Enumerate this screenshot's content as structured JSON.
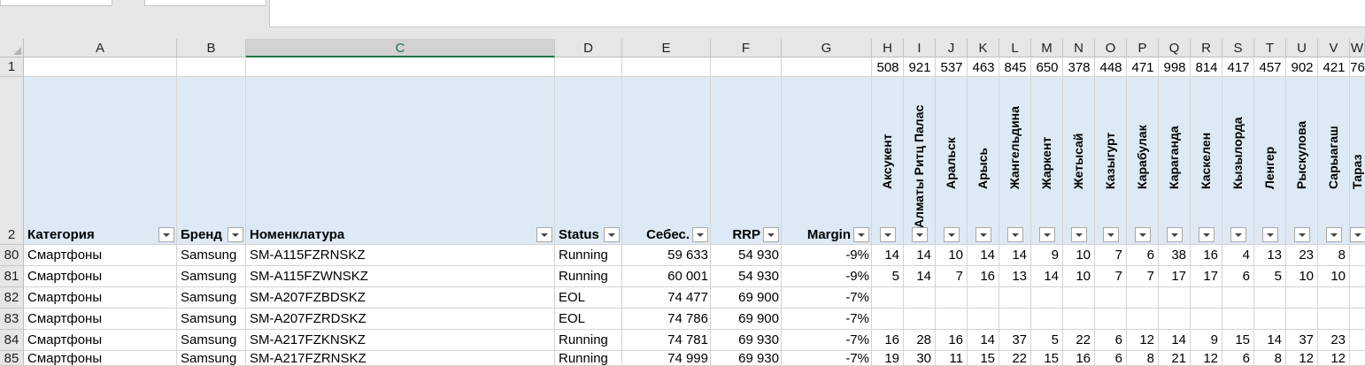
{
  "column_letters": [
    "A",
    "B",
    "C",
    "D",
    "E",
    "F",
    "G",
    "H",
    "I",
    "J",
    "K",
    "L",
    "M",
    "N",
    "O",
    "P",
    "Q",
    "R",
    "S",
    "T",
    "U",
    "V",
    "W"
  ],
  "row1_values": [
    "508",
    "921",
    "537",
    "463",
    "845",
    "650",
    "378",
    "448",
    "471",
    "998",
    "814",
    "417",
    "457",
    "902",
    "421",
    "76"
  ],
  "headers": {
    "category": "Категория",
    "brand": "Бренд",
    "nomenclature": "Номенклатура",
    "status": "Status",
    "cost": "Себес.",
    "rrp": "RRP",
    "margin": "Margin"
  },
  "cities": [
    "Аксукент",
    "Алматы Ритц Палас",
    "Аральск",
    "Арысь",
    "Жангельдина",
    "Жаркент",
    "Жетысай",
    "Казыгурт",
    "Карабулак",
    "Караганда",
    "Каскелен",
    "Кызылорда",
    "Ленгер",
    "Рыскулова",
    "Сарыагаш",
    "Тараз"
  ],
  "row_numbers": [
    "1",
    "2",
    "80",
    "81",
    "82",
    "83",
    "84",
    "85"
  ],
  "rows": [
    {
      "category": "Смартфоны",
      "brand": "Samsung",
      "sku": "SM-A115FZRNSKZ",
      "status": "Running",
      "cost": "59 633",
      "rrp": "54 930",
      "margin": "-9%",
      "stock": [
        "14",
        "14",
        "10",
        "14",
        "14",
        "9",
        "10",
        "7",
        "6",
        "38",
        "16",
        "4",
        "13",
        "23",
        "8",
        ""
      ]
    },
    {
      "category": "Смартфоны",
      "brand": "Samsung",
      "sku": "SM-A115FZWNSKZ",
      "status": "Running",
      "cost": "60 001",
      "rrp": "54 930",
      "margin": "-9%",
      "stock": [
        "5",
        "14",
        "7",
        "16",
        "13",
        "14",
        "10",
        "7",
        "7",
        "17",
        "17",
        "6",
        "5",
        "10",
        "10",
        ""
      ]
    },
    {
      "category": "Смартфоны",
      "brand": "Samsung",
      "sku": "SM-A207FZBDSKZ",
      "status": "EOL",
      "cost": "74 477",
      "rrp": "69 900",
      "margin": "-7%",
      "stock": [
        "",
        "",
        "",
        "",
        "",
        "",
        "",
        "",
        "",
        "",
        "",
        "",
        "",
        "",
        "",
        ""
      ]
    },
    {
      "category": "Смартфоны",
      "brand": "Samsung",
      "sku": "SM-A207FZRDSKZ",
      "status": "EOL",
      "cost": "74 786",
      "rrp": "69 900",
      "margin": "-7%",
      "stock": [
        "",
        "",
        "",
        "",
        "",
        "",
        "",
        "",
        "",
        "",
        "",
        "",
        "",
        "",
        "",
        ""
      ]
    },
    {
      "category": "Смартфоны",
      "brand": "Samsung",
      "sku": "SM-A217FZKNSKZ",
      "status": "Running",
      "cost": "74 781",
      "rrp": "69 930",
      "margin": "-7%",
      "stock": [
        "16",
        "28",
        "16",
        "14",
        "37",
        "5",
        "22",
        "6",
        "12",
        "14",
        "9",
        "15",
        "14",
        "37",
        "23",
        ""
      ]
    },
    {
      "category": "Смартфоны",
      "brand": "Samsung",
      "sku": "SM-A217FZRNSKZ",
      "status": "Running",
      "cost": "74 999",
      "rrp": "69 930",
      "margin": "-7%",
      "stock": [
        "19",
        "30",
        "11",
        "15",
        "22",
        "15",
        "16",
        "6",
        "8",
        "21",
        "12",
        "6",
        "8",
        "12",
        "12",
        ""
      ]
    }
  ],
  "colors": {
    "header_fill": "#dde9f5",
    "selected_column": "#217346",
    "chrome": "#e6e6e6"
  }
}
